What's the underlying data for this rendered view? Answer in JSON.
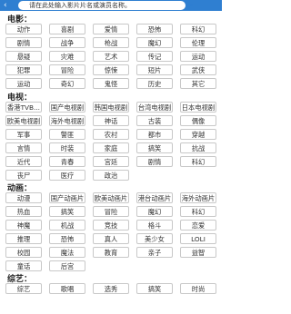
{
  "search": {
    "placeholder": "请在此处输入影片片名或演员名称。"
  },
  "sections": [
    {
      "title": "电影：",
      "items": [
        "动作",
        "喜剧",
        "爱情",
        "恐怖",
        "科幻",
        "剧情",
        "战争",
        "枪战",
        "魔幻",
        "伦理",
        "悬疑",
        "灾难",
        "艺术",
        "传记",
        "运动",
        "犯罪",
        "冒险",
        "惊悚",
        "短片",
        "武侠",
        "运动",
        "奇幻",
        "鬼怪",
        "历史",
        "其它"
      ]
    },
    {
      "title": "电视：",
      "items": [
        "香港TVB...",
        "国产电视剧",
        "韩国电视剧",
        "台湾电视剧",
        "日本电视剧",
        "欧美电视剧",
        "海外电视剧",
        "神话",
        "古装",
        "偶像",
        "军事",
        "警匪",
        "农村",
        "都市",
        "穿越",
        "言情",
        "时装",
        "家庭",
        "搞笑",
        "抗战",
        "近代",
        "青春",
        "宫廷",
        "剧情",
        "科幻",
        "丧尸",
        "医疗",
        "政治"
      ]
    },
    {
      "title": "动画：",
      "items": [
        "动漫",
        "国产动画片",
        "欧美动画片",
        "港台动画片",
        "海外动画片",
        "热血",
        "搞笑",
        "冒险",
        "魔幻",
        "科幻",
        "神魔",
        "机战",
        "竞技",
        "格斗",
        "恋爱",
        "推理",
        "恐怖",
        "真人",
        "美少女",
        "LOLI",
        "校园",
        "魔法",
        "教育",
        "亲子",
        "益智",
        "童话",
        "后宫"
      ]
    },
    {
      "title": "综艺：",
      "items": [
        "综艺",
        "歌唱",
        "选秀",
        "搞笑",
        "时尚"
      ]
    }
  ]
}
